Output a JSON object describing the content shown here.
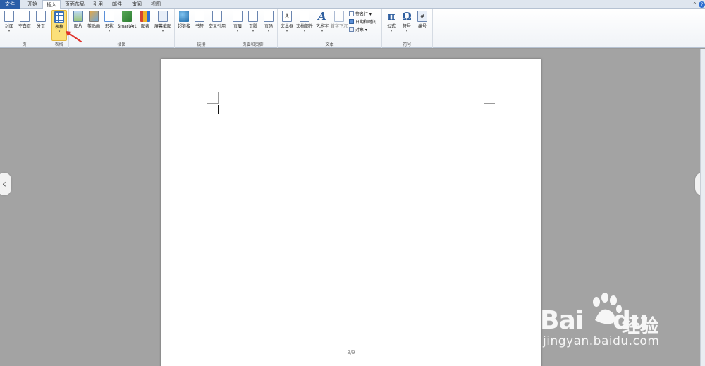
{
  "tabs": [
    {
      "label": "文件"
    },
    {
      "label": "开始"
    },
    {
      "label": "插入"
    },
    {
      "label": "页面布局"
    },
    {
      "label": "引用"
    },
    {
      "label": "邮件"
    },
    {
      "label": "审阅"
    },
    {
      "label": "视图"
    }
  ],
  "ribbon": {
    "groups": {
      "pages": "页",
      "tables": "表格",
      "illustrations": "插图",
      "links": "链接",
      "header_footer": "页眉和页脚",
      "text": "文本",
      "symbols": "符号"
    },
    "buttons": {
      "cover": "封面",
      "blank_page": "空白页",
      "page_break": "分页",
      "table": "表格",
      "picture": "图片",
      "clipart": "剪贴画",
      "shapes": "形状",
      "smartart": "SmartArt",
      "chart": "图表",
      "screenshot": "屏幕截图",
      "hyperlink": "超链接",
      "bookmark": "书签",
      "cross_ref": "交叉引用",
      "header": "页眉",
      "footer": "页脚",
      "page_number": "页码",
      "textbox": "文本框",
      "quick_parts": "文档部件",
      "wordart": "艺术字",
      "dropcap": "首字下沉",
      "signature": "签名行",
      "datetime": "日期和时间",
      "object": "对象",
      "equation": "公式",
      "symbol": "符号",
      "number": "编号",
      "equation_glyph": "π",
      "symbol_glyph": "Ω"
    }
  },
  "document": {
    "page_indicator": "3/9"
  },
  "watermark": {
    "logo_text": "Bai",
    "logo_text2": "du",
    "brand_cn": "经验",
    "url": "jingyan.baidu.com"
  },
  "colors": {
    "file_tab": "#2a5ea8",
    "selected_button": "#fbe07a",
    "annotation_arrow": "#e0322b"
  }
}
